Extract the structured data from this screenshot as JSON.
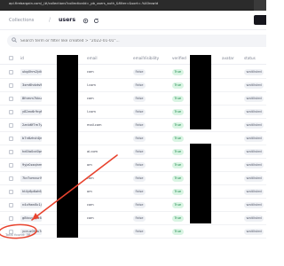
{
  "browser": {
    "url": "api.firebargain.com/_/#/collections?collectionId=_pb_users_auth_&filter=&sort=-%40rowid"
  },
  "header": {
    "breadcrumb_parent": "Collections",
    "breadcrumb_sep": "/",
    "breadcrumb_current": "users",
    "settings_icon": "gear-icon",
    "refresh_icon": "refresh-icon"
  },
  "search": {
    "icon": "search-icon",
    "placeholder": "Search term or filter like created > \"2022-01-01\"..."
  },
  "table": {
    "columns": [
      "id",
      "email",
      "emailVisibility",
      "verified",
      "name",
      "avatar",
      "status"
    ],
    "rows": [
      {
        "id": "ubg0hm2jdlomr",
        "email": "com",
        "emailVisibility": "False",
        "verified": "True",
        "avatar": "N/A",
        "status": "waitlisted"
      },
      {
        "id": "3xm6hdvts9ni7cc",
        "email": "l.com",
        "emailVisibility": "False",
        "verified": "True",
        "avatar": "N/A",
        "status": "waitlisted"
      },
      {
        "id": "8fnmm7kbu3hbo",
        "email": "com",
        "emailVisibility": "False",
        "verified": "True",
        "avatar": "N/A",
        "status": "waitlisted"
      },
      {
        "id": "y82ex6r9rgfg2pc",
        "email": "l.com",
        "emailVisibility": "False",
        "verified": "True",
        "avatar": "N/A",
        "status": "waitlisted"
      },
      {
        "id": "2znb6f7m7yd5jwt",
        "email": "mail.com",
        "emailVisibility": "False",
        "verified": "True",
        "avatar": "N/A",
        "status": "waitlisted"
      },
      {
        "id": "b7n6zhvt4jml3k",
        "email": "",
        "emailVisibility": "False",
        "verified": "True",
        "avatar": "N/A",
        "status": "waitlisted"
      },
      {
        "id": "hd0la0cd0ps4ne",
        "email": "ai.com",
        "emailVisibility": "False",
        "verified": "True",
        "avatar": "N/A",
        "status": "waitlisted"
      },
      {
        "id": "9yjz0zzqlnm9mad",
        "email": "om",
        "emailVisibility": "False",
        "verified": "True",
        "avatar": "N/A",
        "status": "waitlisted"
      },
      {
        "id": "7br7omvurl9mfd",
        "email": "com",
        "emailVisibility": "False",
        "verified": "True",
        "avatar": "N/A",
        "status": "waitlisted"
      },
      {
        "id": "ht4y6p6ah6jyhrv",
        "email": "om",
        "emailVisibility": "False",
        "verified": "True",
        "avatar": "N/A",
        "status": "waitlisted"
      },
      {
        "id": "n4x9wn8c1j0bv",
        "email": "com",
        "emailVisibility": "False",
        "verified": "True",
        "avatar": "N/A",
        "status": "waitlisted"
      },
      {
        "id": "g8kxvusy56gmlw",
        "email": "com",
        "emailVisibility": "False",
        "verified": "True",
        "avatar": "N/A",
        "status": "waitlisted"
      },
      {
        "id": "ycnuz0fyw7dxpxb",
        "email": "",
        "emailVisibility": "False",
        "verified": "True",
        "avatar": "N/A",
        "status": "waitlisted"
      },
      {
        "id": "jyoqp7gxbnc4yvm",
        "email": "com",
        "emailVisibility": "False",
        "verified": "True",
        "avatar": "N/A",
        "status": "waitlisted"
      }
    ]
  },
  "footer": {
    "total_found": "Total found: 38"
  },
  "colors": {
    "annotation": "#e8432e",
    "verified_true_bg": "#d9f4e3",
    "verified_true_fg": "#1f8a4c",
    "redaction": "#000000"
  }
}
